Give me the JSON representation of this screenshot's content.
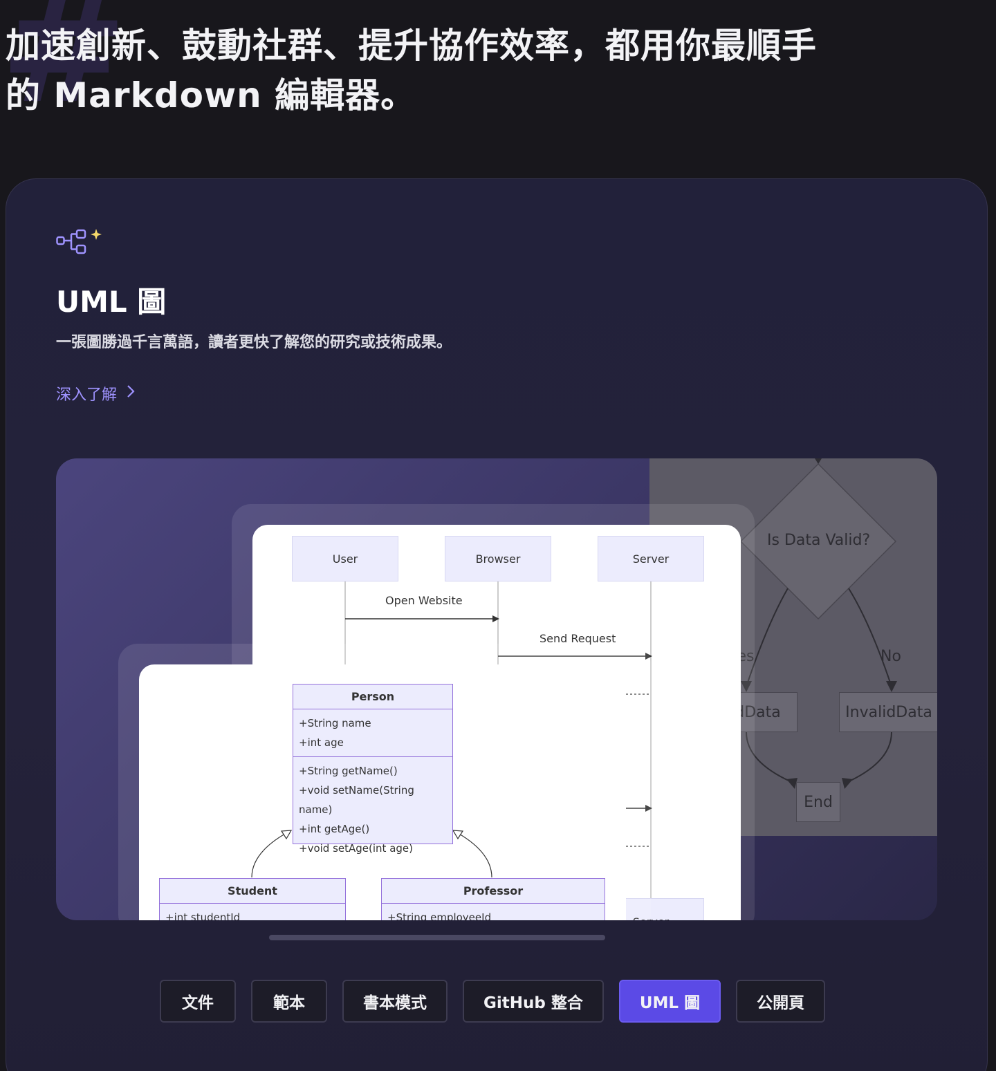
{
  "hero": {
    "line1": "加速創新、鼓動社群、提升協作效率，都用你最順手",
    "line2": "的 Markdown 編輯器。"
  },
  "feature": {
    "icon": "flowchart-sparkle-icon",
    "title": "UML 圖",
    "description": "一張圖勝過千言萬語，讀者更快了解您的研究或技術成果。",
    "learn_more": "深入了解"
  },
  "sequence_diagram": {
    "actors": [
      "User",
      "Browser",
      "Server"
    ],
    "messages": [
      "Open Website",
      "Send Request"
    ],
    "partial_actor": "Server"
  },
  "class_diagram": {
    "person": {
      "name": "Person",
      "attributes": [
        "+String name",
        "+int age"
      ],
      "methods": [
        "+String getName()",
        "+void setName(String name)",
        "+int getAge()",
        "+void setAge(int age)"
      ]
    },
    "student": {
      "name": "Student",
      "attribute": "+int studentId"
    },
    "professor": {
      "name": "Professor",
      "attribute": "+String employeeId"
    }
  },
  "flowchart": {
    "decision": "Is Data Valid?",
    "yes_label": "Yes",
    "no_label": "No",
    "valid": "ValidData",
    "invalid": "InvalidData",
    "end": "End"
  },
  "tabs": [
    {
      "label": "文件",
      "active": false
    },
    {
      "label": "範本",
      "active": false
    },
    {
      "label": "書本模式",
      "active": false
    },
    {
      "label": "GitHub 整合",
      "active": false
    },
    {
      "label": "UML 圖",
      "active": true
    },
    {
      "label": "公開頁",
      "active": false
    }
  ],
  "colors": {
    "background": "#18171c",
    "accent": "#5b4ae6",
    "link": "#9f93ff",
    "uml_fill": "#ececfd",
    "uml_border": "#9370db"
  }
}
